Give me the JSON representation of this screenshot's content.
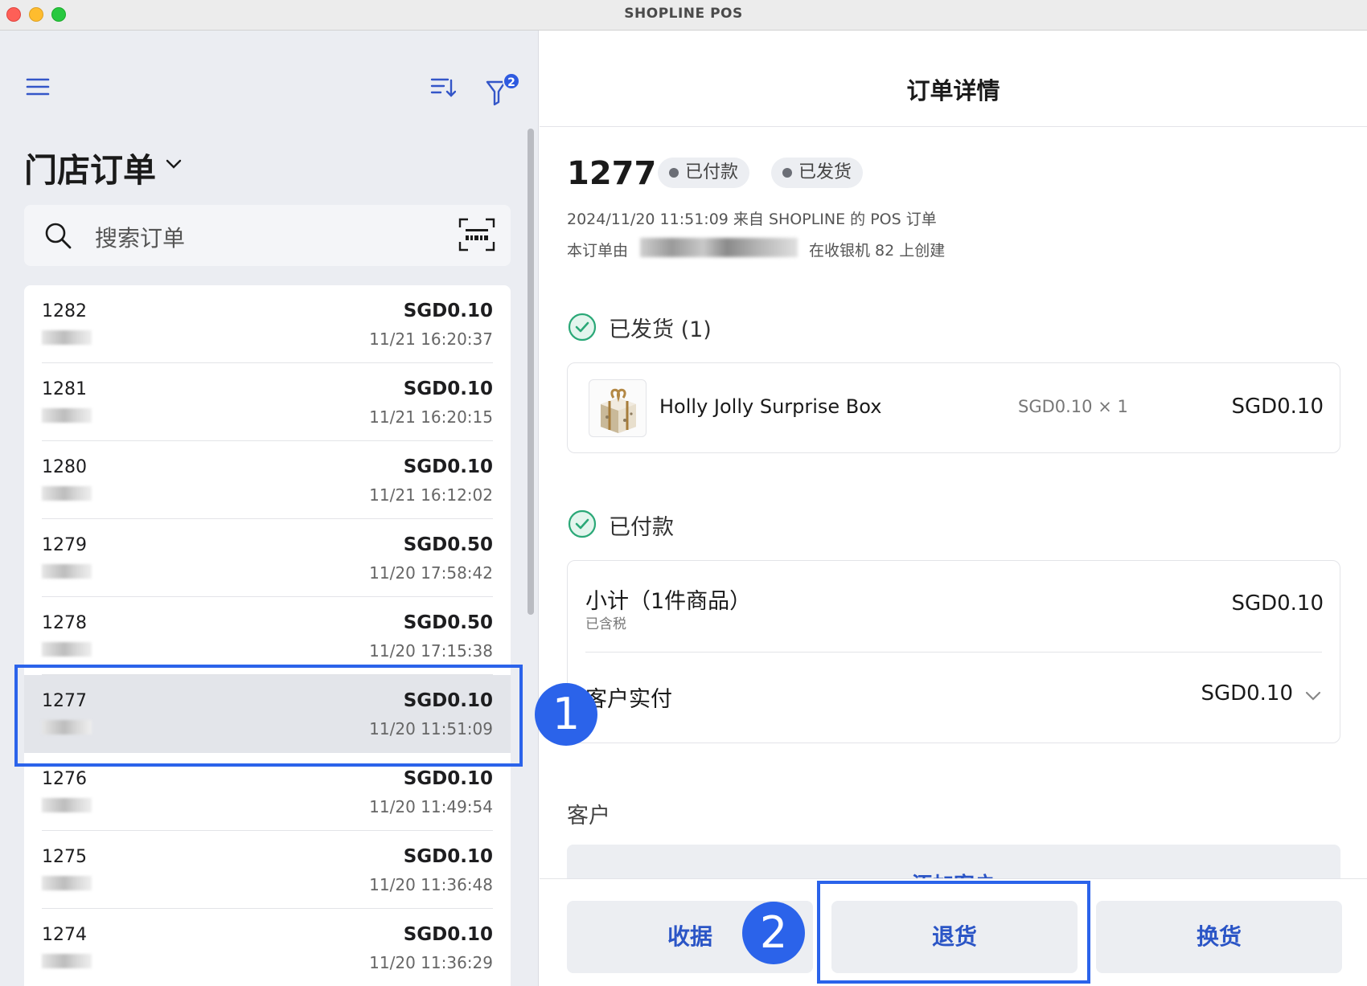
{
  "window": {
    "title": "SHOPLINE POS"
  },
  "left_panel": {
    "filter_badge": "2",
    "title": "门店订单",
    "search_placeholder": "搜索订单",
    "orders": [
      {
        "id": "1282",
        "amount": "SGD0.10",
        "time": "11/21 16:20:37",
        "selected": false
      },
      {
        "id": "1281",
        "amount": "SGD0.10",
        "time": "11/21 16:20:15",
        "selected": false
      },
      {
        "id": "1280",
        "amount": "SGD0.10",
        "time": "11/21 16:12:02",
        "selected": false
      },
      {
        "id": "1279",
        "amount": "SGD0.50",
        "time": "11/20 17:58:42",
        "selected": false
      },
      {
        "id": "1278",
        "amount": "SGD0.50",
        "time": "11/20 17:15:38",
        "selected": false
      },
      {
        "id": "1277",
        "amount": "SGD0.10",
        "time": "11/20 11:51:09",
        "selected": true
      },
      {
        "id": "1276",
        "amount": "SGD0.10",
        "time": "11/20 11:49:54",
        "selected": false
      },
      {
        "id": "1275",
        "amount": "SGD0.10",
        "time": "11/20 11:36:48",
        "selected": false
      },
      {
        "id": "1274",
        "amount": "SGD0.10",
        "time": "11/20 11:36:29",
        "selected": false
      }
    ]
  },
  "detail": {
    "header_title": "订单详情",
    "order_number": "1277",
    "tags": [
      "已付款",
      "已发货"
    ],
    "meta_line": "2024/11/20 11:51:09 来自 SHOPLINE 的 POS 订单",
    "created_prefix": "本订单由",
    "created_suffix": "在收银机  82  上创建",
    "shipped_title": "已发货 (1)",
    "item": {
      "name": "Holly Jolly Surprise Box",
      "unit": "SGD0.10 × 1",
      "total": "SGD0.10"
    },
    "paid_title": "已付款",
    "subtotal_label": "小计（1件商品）",
    "tax_note": "已含税",
    "subtotal_value": "SGD0.10",
    "paid_label": "客户实付",
    "paid_value": "SGD0.10",
    "customer_title": "客户",
    "add_customer": "添加客户"
  },
  "actions": {
    "receipt": "收据",
    "return": "退货",
    "exchange": "换货"
  },
  "annotations": {
    "step1": "1",
    "step2": "2"
  },
  "colors": {
    "accent": "#2b63ea",
    "link_blue": "#2b55c6",
    "check_green": "#2aa877"
  }
}
